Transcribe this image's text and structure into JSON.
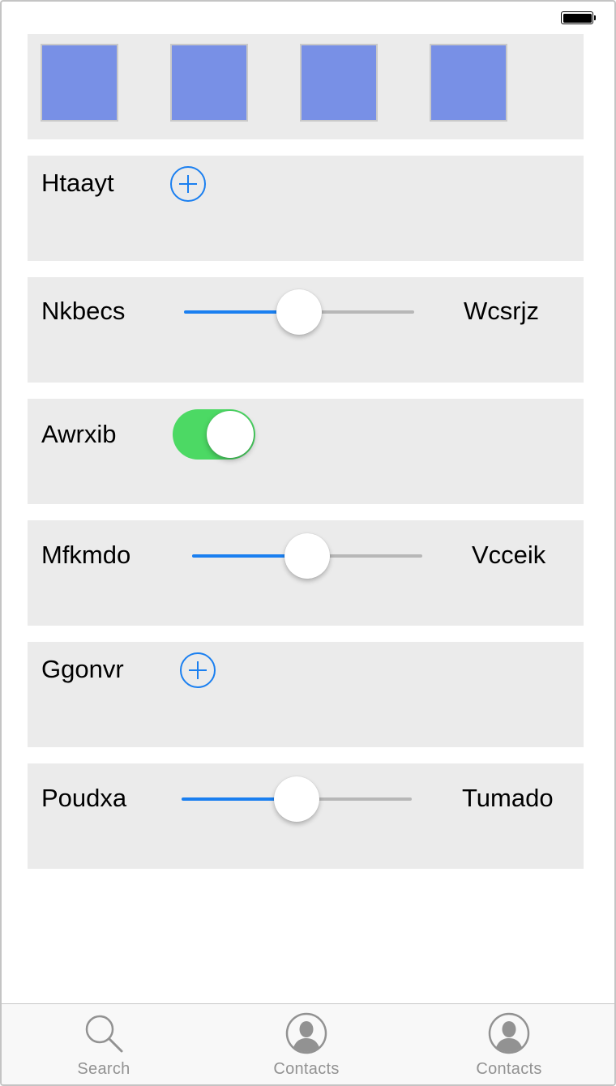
{
  "status_bar": {
    "battery_icon": "battery-full-icon",
    "battery_level": 1.0
  },
  "tiles": [
    {
      "color": "#7890e6"
    },
    {
      "color": "#7890e6"
    },
    {
      "color": "#7890e6"
    },
    {
      "color": "#7890e6"
    }
  ],
  "rows": {
    "htaayt": {
      "label": "Htaayt",
      "button_icon": "plus-circle-icon"
    },
    "nkbecs": {
      "label": "Nkbecs",
      "right_label": "Wcsrjz",
      "slider_value": 0.5
    },
    "awrxib": {
      "label": "Awrxib",
      "toggle_on": true
    },
    "mfkmdo": {
      "label": "Mfkmdo",
      "right_label": "Vcceik",
      "slider_value": 0.5
    },
    "ggonvr": {
      "label": "Ggonvr",
      "button_icon": "plus-circle-icon"
    },
    "poudxa": {
      "label": "Poudxa",
      "right_label": "Tumado",
      "slider_value": 0.5
    }
  },
  "tabbar": {
    "items": [
      {
        "label": "Search",
        "icon": "search-icon"
      },
      {
        "label": "Contacts",
        "icon": "contact-icon"
      },
      {
        "label": "Contacts",
        "icon": "contact-icon"
      }
    ]
  },
  "colors": {
    "accent": "#1a7ff0",
    "toggle_on": "#4cd964",
    "panel_bg": "#ebebeb",
    "tile": "#7890e6"
  }
}
